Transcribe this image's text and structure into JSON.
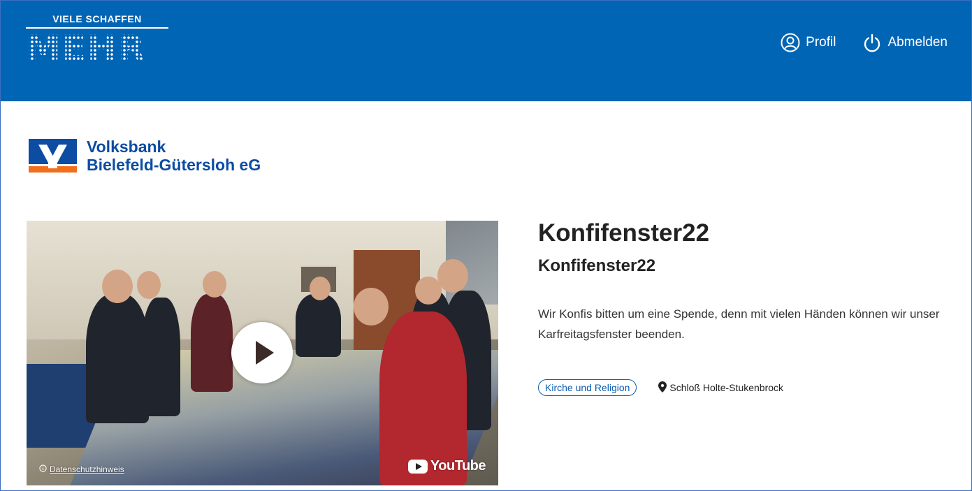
{
  "header": {
    "brand_top": "VIELE SCHAFFEN",
    "brand_main": "MEHR",
    "nav": {
      "profile_label": "Profil",
      "logout_label": "Abmelden"
    }
  },
  "bank": {
    "name_line1": "Volksbank",
    "name_line2": "Bielefeld-Gütersloh eG"
  },
  "video": {
    "privacy_label": "Datenschutzhinweis",
    "youtube_label": "YouTube"
  },
  "project": {
    "title": "Konfifenster22",
    "subtitle": "Konfifenster22",
    "description": "Wir Konfis bitten um eine Spende, denn mit vielen Händen können wir unser Karfreitagsfenster beenden.",
    "category": "Kirche und Religion",
    "location": "Schloß Holte-Stukenbrock"
  },
  "colors": {
    "header_bg": "#0165b5",
    "bank_blue": "#0c4ca3",
    "bank_orange": "#f06e1c",
    "tag_blue": "#0c5db0"
  }
}
